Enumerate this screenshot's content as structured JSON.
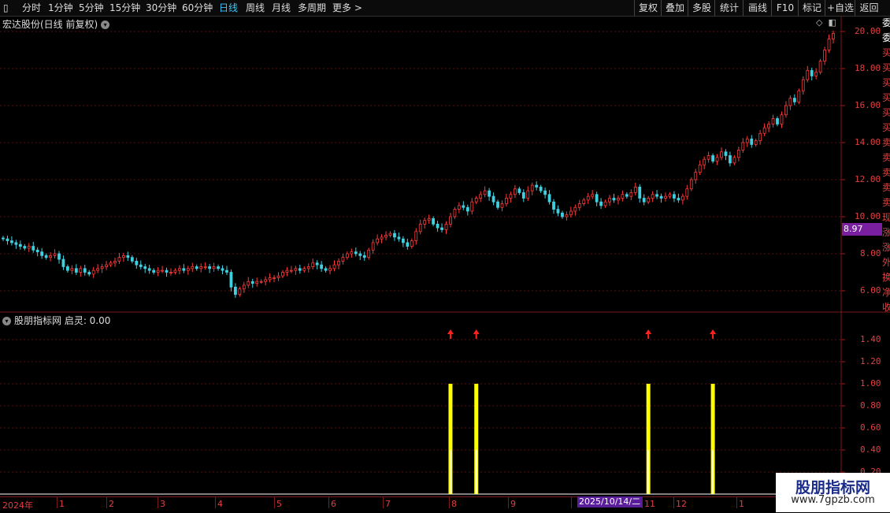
{
  "toolbar": {
    "periods": [
      "分时",
      "1分钟",
      "5分钟",
      "15分钟",
      "30分钟",
      "60分钟",
      "日线",
      "周线",
      "月线",
      "多周期",
      "更多 >"
    ],
    "active_period": "日线",
    "right_buttons": [
      "复权",
      "叠加",
      "多股",
      "统计",
      "画线",
      "F10",
      "标记",
      "+自选",
      "返回"
    ]
  },
  "main": {
    "title": "宏达股份(日线 前复权)",
    "y_labels": [
      "20.00",
      "18.00",
      "16.00",
      "14.00",
      "12.00",
      "10.00",
      "8.00",
      "6.00"
    ],
    "current_price": "8.97"
  },
  "indicator": {
    "title": "股朋指标网  启灵: 0.00",
    "y_labels": [
      "1.40",
      "1.20",
      "1.00",
      "0.80",
      "0.60",
      "0.40",
      "0.20"
    ]
  },
  "date_axis": {
    "labels": [
      "2024年",
      "1",
      "2",
      "3",
      "4",
      "5",
      "6",
      "7",
      "8",
      "9",
      "11",
      "12",
      "1"
    ],
    "cursor_date": "2025/10/14/二"
  },
  "right_strip": {
    "chars": [
      "委",
      "委",
      "买",
      "买",
      "买",
      "买",
      "买",
      "买",
      "卖",
      "卖",
      "卖",
      "卖",
      "卖",
      "现",
      "涨",
      "涨",
      "外",
      "换",
      "净",
      "收"
    ]
  },
  "watermark": {
    "title": "股朋指标网",
    "url": "www.7gpzb.com"
  },
  "colors": {
    "up": "#ff3b3b",
    "down": "#3fd0e0",
    "signal": "#ffff00",
    "arrow": "#ff2020",
    "grid": "#5a1010"
  },
  "chart_data": {
    "type": "candlestick",
    "ylim": [
      5.5,
      20.5
    ],
    "closes": [
      8.8,
      8.7,
      8.6,
      8.5,
      8.4,
      8.3,
      8.4,
      8.2,
      8.1,
      7.9,
      7.8,
      7.9,
      8.0,
      7.7,
      7.3,
      7.1,
      7.2,
      7.0,
      7.2,
      7.0,
      6.9,
      7.1,
      7.2,
      7.3,
      7.4,
      7.5,
      7.6,
      7.8,
      7.9,
      7.8,
      7.6,
      7.4,
      7.3,
      7.2,
      7.1,
      7.0,
      7.1,
      7.1,
      7.0,
      7.0,
      7.1,
      7.2,
      7.1,
      7.2,
      7.3,
      7.2,
      7.3,
      7.3,
      7.2,
      7.3,
      7.2,
      7.1,
      7.0,
      6.2,
      5.8,
      6.1,
      6.3,
      6.5,
      6.4,
      6.5,
      6.5,
      6.6,
      6.7,
      6.7,
      6.8,
      7.0,
      7.1,
      7.1,
      7.2,
      7.1,
      7.2,
      7.3,
      7.5,
      7.4,
      7.2,
      7.1,
      7.2,
      7.4,
      7.6,
      7.8,
      8.0,
      8.1,
      8.0,
      7.9,
      7.8,
      8.2,
      8.6,
      8.8,
      8.9,
      9.0,
      9.1,
      8.9,
      8.8,
      8.6,
      8.4,
      8.7,
      9.2,
      9.6,
      9.8,
      9.9,
      9.6,
      9.4,
      9.3,
      9.6,
      10.0,
      10.4,
      10.6,
      10.5,
      10.3,
      10.8,
      11.0,
      11.2,
      11.4,
      11.1,
      10.8,
      10.5,
      10.7,
      11.0,
      11.2,
      11.5,
      11.3,
      11.0,
      11.4,
      11.7,
      11.6,
      11.4,
      11.2,
      10.8,
      10.4,
      10.2,
      10.0,
      10.1,
      10.3,
      10.5,
      10.7,
      10.9,
      11.1,
      11.2,
      10.8,
      10.6,
      10.8,
      11.0,
      10.9,
      11.0,
      11.2,
      11.1,
      11.3,
      11.6,
      11.0,
      10.8,
      11.0,
      11.2,
      11.1,
      11.0,
      11.1,
      11.2,
      11.0,
      10.9,
      11.1,
      11.5,
      12.0,
      12.4,
      12.8,
      13.1,
      13.3,
      13.0,
      13.2,
      13.5,
      13.3,
      12.9,
      13.2,
      13.6,
      14.0,
      14.2,
      13.9,
      14.1,
      14.5,
      14.8,
      15.0,
      15.3,
      15.0,
      15.5,
      16.0,
      16.4,
      16.2,
      16.8,
      17.4,
      17.9,
      17.6,
      17.8,
      18.4,
      19.0,
      19.6,
      19.9
    ],
    "signals": [
      {
        "index": 104,
        "value": 1.0
      },
      {
        "index": 110,
        "value": 1.0
      },
      {
        "index": 150,
        "value": 1.0
      },
      {
        "index": 165,
        "value": 1.0
      }
    ],
    "indicator_ylim": [
      0.0,
      1.5
    ]
  }
}
